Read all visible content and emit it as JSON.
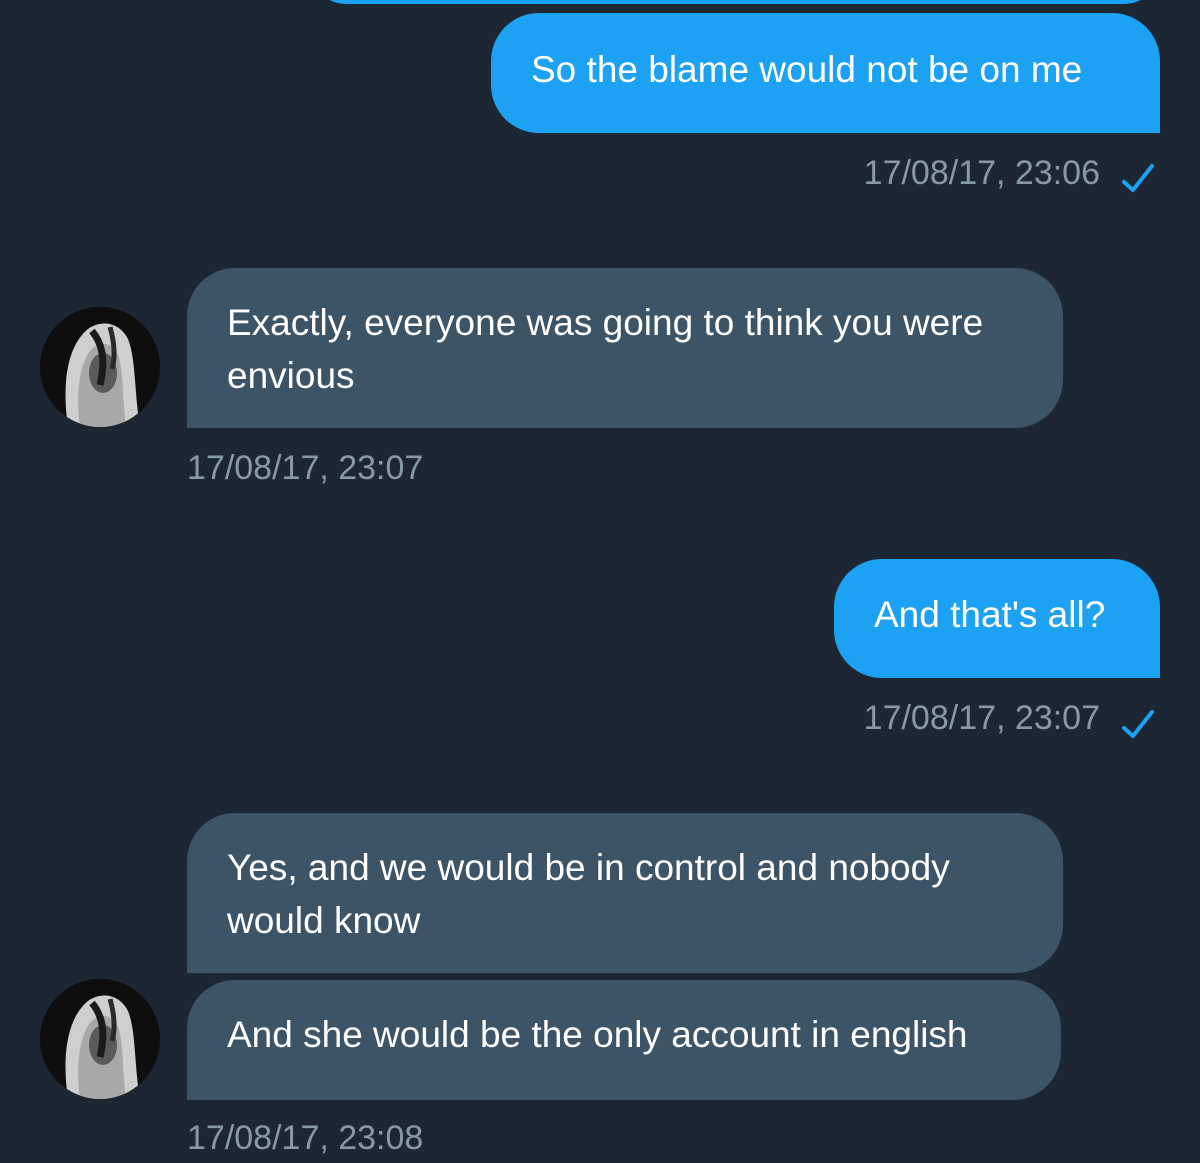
{
  "messages": [
    {
      "direction": "sent",
      "text": "So the blame would not be on me",
      "time": "17/08/17, 23:06"
    },
    {
      "direction": "received",
      "text": "Exactly, everyone was going to think you were envious",
      "time": "17/08/17, 23:07"
    },
    {
      "direction": "sent",
      "text": "And that's all?",
      "time": "17/08/17, 23:07"
    },
    {
      "direction": "received",
      "text": "Yes, and we would be in control and nobody would know"
    },
    {
      "direction": "received",
      "text": "And she would be the only account in english",
      "time": "17/08/17, 23:08"
    }
  ],
  "icons": {
    "read_receipt": "checkmark-icon",
    "avatar": "contact-avatar"
  },
  "colors": {
    "background": "#1c2733",
    "sent_bubble": "#1da1f2",
    "received_bubble": "#3d5466",
    "timestamp": "#8899a6",
    "checkmark": "#1da1f2"
  }
}
